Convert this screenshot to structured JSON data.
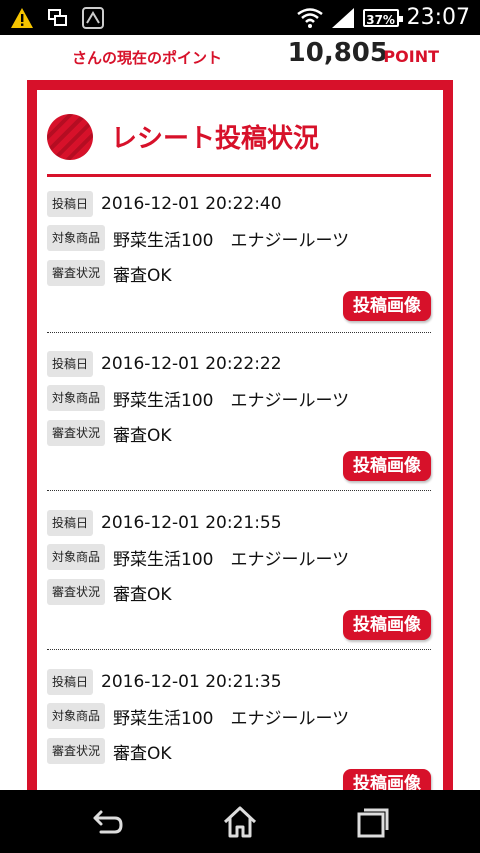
{
  "status_bar": {
    "time": "23:07",
    "battery": "37%",
    "icons": [
      "warning-icon",
      "screen-mirror-icon",
      "nfc-on-icon",
      "wifi-icon",
      "signal-icon",
      "battery-icon"
    ]
  },
  "header": {
    "label": "さんの現在のポイント",
    "points": "10,805",
    "unit": "POINT"
  },
  "section": {
    "title": "レシート投稿状況"
  },
  "entries": [
    {
      "date_tag": "投稿日",
      "date": "2016-12-01 20:22:40",
      "product_tag": "対象商品",
      "product": "野菜生活100　エナジールーツ",
      "status_tag": "審査状況",
      "status": "審査OK",
      "button": "投稿画像"
    },
    {
      "date_tag": "投稿日",
      "date": "2016-12-01 20:22:22",
      "product_tag": "対象商品",
      "product": "野菜生活100　エナジールーツ",
      "status_tag": "審査状況",
      "status": "審査OK",
      "button": "投稿画像"
    },
    {
      "date_tag": "投稿日",
      "date": "2016-12-01 20:21:55",
      "product_tag": "対象商品",
      "product": "野菜生活100　エナジールーツ",
      "status_tag": "審査状況",
      "status": "審査OK",
      "button": "投稿画像"
    },
    {
      "date_tag": "投稿日",
      "date": "2016-12-01 20:21:35",
      "product_tag": "対象商品",
      "product": "野菜生活100　エナジールーツ",
      "status_tag": "審査状況",
      "status": "審査OK",
      "button": "投稿画像"
    }
  ],
  "colors": {
    "accent": "#d7112a",
    "tag_bg": "#e4e4e4"
  },
  "nav": {
    "icons": [
      "back-icon",
      "home-icon",
      "recent-apps-icon"
    ]
  }
}
